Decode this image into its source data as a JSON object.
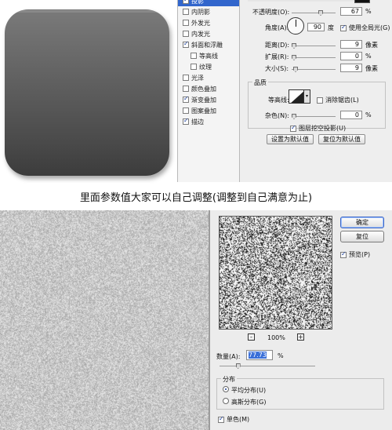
{
  "layer_style": {
    "styles": [
      {
        "label": "投影",
        "checked": true,
        "selected": true,
        "indent": false
      },
      {
        "label": "内阴影",
        "checked": false,
        "selected": false,
        "indent": false
      },
      {
        "label": "外发光",
        "checked": false,
        "selected": false,
        "indent": false
      },
      {
        "label": "内发光",
        "checked": false,
        "selected": false,
        "indent": false
      },
      {
        "label": "斜面和浮雕",
        "checked": true,
        "selected": false,
        "indent": false
      },
      {
        "label": "等高线",
        "checked": false,
        "selected": false,
        "indent": true
      },
      {
        "label": "纹理",
        "checked": false,
        "selected": false,
        "indent": true
      },
      {
        "label": "光泽",
        "checked": false,
        "selected": false,
        "indent": false
      },
      {
        "label": "颜色叠加",
        "checked": false,
        "selected": false,
        "indent": false
      },
      {
        "label": "渐变叠加",
        "checked": true,
        "selected": false,
        "indent": false
      },
      {
        "label": "图案叠加",
        "checked": false,
        "selected": false,
        "indent": false
      },
      {
        "label": "描边",
        "checked": true,
        "selected": false,
        "indent": false
      }
    ],
    "opacity_label": "不透明度(O):",
    "opacity_value": "67",
    "opacity_unit": "%",
    "angle_label": "角度(A):",
    "angle_value": "90",
    "angle_unit": "度",
    "global_light_label": "使用全局光(G)",
    "distance_label": "距离(D):",
    "distance_value": "9",
    "spread_label": "扩展(R):",
    "spread_value": "0",
    "size_label": "大小(S):",
    "size_value": "9",
    "pixel_unit": "像素",
    "percent_unit": "%",
    "quality_title": "品质",
    "contour_label": "等高线:",
    "antialias_label": "消除锯齿(L)",
    "noise_label": "杂色(N):",
    "noise_value": "0",
    "knockout_label": "图层挖空投影(U)",
    "set_default_button": "设置为默认值",
    "reset_default_button": "复位为默认值"
  },
  "caption": "里面参数值大家可以自己调整(调整到自己满意为止)",
  "add_noise": {
    "ok_button": "确定",
    "reset_button": "复位",
    "preview_label": "预览(P)",
    "preview_checked": true,
    "zoom_out": "-",
    "zoom_in": "+",
    "zoom_level": "100%",
    "amount_label": "数量(A):",
    "amount_value": "77.73",
    "amount_unit": "%",
    "amount_fraction": 0.194,
    "distribution_title": "分布",
    "uniform_label": "平均分布(U)",
    "gaussian_label": "高斯分布(G)",
    "uniform_selected": true,
    "monochromatic_label": "单色(M)",
    "monochromatic_checked": true
  }
}
